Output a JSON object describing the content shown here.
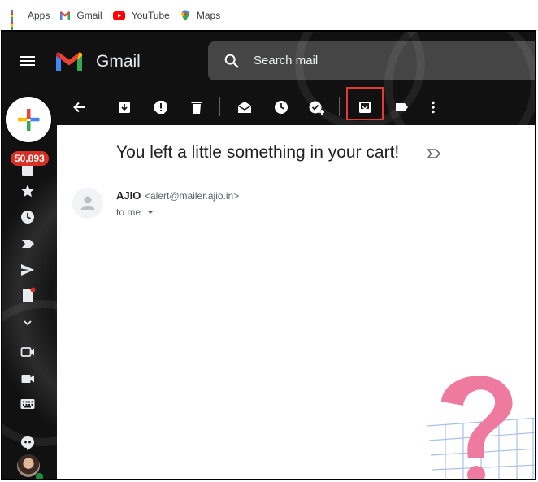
{
  "bookmarks": [
    {
      "label": "Apps",
      "icon": "apps-grid-icon"
    },
    {
      "label": "Gmail",
      "icon": "gmail-icon"
    },
    {
      "label": "YouTube",
      "icon": "youtube-icon"
    },
    {
      "label": "Maps",
      "icon": "maps-icon"
    }
  ],
  "header": {
    "brand": "Gmail",
    "search_placeholder": "Search mail"
  },
  "sidebar": {
    "unread_count": "50,893",
    "icons": [
      "inbox-icon",
      "star-icon",
      "clock-icon",
      "label-icon",
      "send-icon",
      "draft-icon",
      "expand-more-icon",
      "video-icon",
      "meet-icon",
      "keyboard-icon",
      "chat-icon"
    ]
  },
  "toolbar": {
    "icons": [
      "back-arrow-icon",
      "archive-icon",
      "report-spam-icon",
      "delete-icon",
      "mark-unread-icon",
      "snooze-icon",
      "add-task-icon",
      "move-to-icon",
      "label-icon",
      "more-vert-icon"
    ],
    "highlighted": "move-to-icon"
  },
  "email": {
    "subject": "You left a little something in your cart!",
    "sender_name": "AJIO",
    "sender_email": "<alert@mailer.ajio.in>",
    "recipient": "to me"
  },
  "colors": {
    "badge": "#d93025",
    "highlight": "#e53935",
    "deco_pink": "#ef7aa0"
  }
}
